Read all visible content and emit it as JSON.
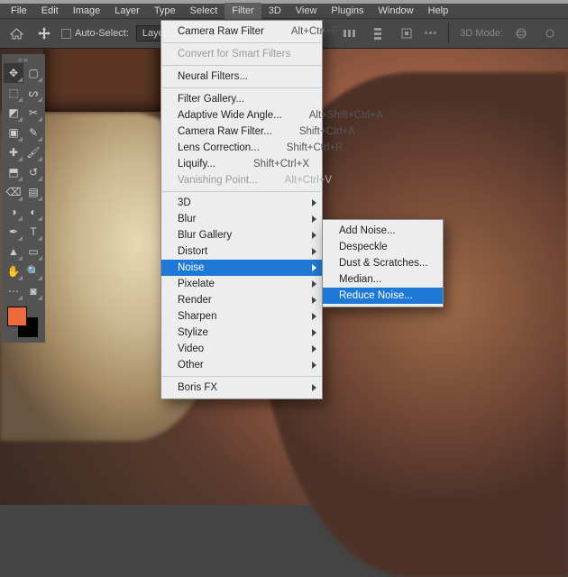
{
  "menubar": {
    "items": [
      "File",
      "Edit",
      "Image",
      "Layer",
      "Type",
      "Select",
      "Filter",
      "3D",
      "View",
      "Plugins",
      "Window",
      "Help"
    ],
    "open_index": 6
  },
  "optbar": {
    "auto_select_label": "Auto-Select:",
    "auto_select_checked": false,
    "target_dropdown": "Layer",
    "mode_label": "3D Mode:"
  },
  "toolbox": {
    "tools": [
      {
        "name": "move-tool",
        "selected": true
      },
      {
        "name": "artboard-tool"
      },
      {
        "name": "rect-marquee-tool"
      },
      {
        "name": "lasso-tool"
      },
      {
        "name": "object-select-tool"
      },
      {
        "name": "crop-tool"
      },
      {
        "name": "frame-tool"
      },
      {
        "name": "eyedropper-tool"
      },
      {
        "name": "healing-brush-tool"
      },
      {
        "name": "brush-tool"
      },
      {
        "name": "clone-stamp-tool"
      },
      {
        "name": "history-brush-tool"
      },
      {
        "name": "eraser-tool"
      },
      {
        "name": "gradient-tool"
      },
      {
        "name": "blur-tool"
      },
      {
        "name": "dodge-tool"
      },
      {
        "name": "pen-tool"
      },
      {
        "name": "type-tool"
      },
      {
        "name": "path-select-tool"
      },
      {
        "name": "rectangle-tool"
      },
      {
        "name": "hand-tool"
      },
      {
        "name": "zoom-tool"
      },
      {
        "name": "edit-toolbar"
      },
      {
        "name": "quick-mask"
      }
    ],
    "foreground_color": "#f06a3c",
    "background_color": "#000000"
  },
  "filter_menu": {
    "sections": [
      [
        {
          "label": "Camera Raw Filter",
          "shortcut": "Alt+Ctrl+F"
        }
      ],
      [
        {
          "label": "Convert for Smart Filters",
          "disabled": true
        }
      ],
      [
        {
          "label": "Neural Filters..."
        }
      ],
      [
        {
          "label": "Filter Gallery..."
        },
        {
          "label": "Adaptive Wide Angle...",
          "shortcut": "Alt+Shift+Ctrl+A"
        },
        {
          "label": "Camera Raw Filter...",
          "shortcut": "Shift+Ctrl+A"
        },
        {
          "label": "Lens Correction...",
          "shortcut": "Shift+Ctrl+R"
        },
        {
          "label": "Liquify...",
          "shortcut": "Shift+Ctrl+X"
        },
        {
          "label": "Vanishing Point...",
          "shortcut": "Alt+Ctrl+V",
          "disabled": true
        }
      ],
      [
        {
          "label": "3D",
          "submenu": true
        },
        {
          "label": "Blur",
          "submenu": true
        },
        {
          "label": "Blur Gallery",
          "submenu": true
        },
        {
          "label": "Distort",
          "submenu": true
        },
        {
          "label": "Noise",
          "submenu": true,
          "highlighted": true
        },
        {
          "label": "Pixelate",
          "submenu": true
        },
        {
          "label": "Render",
          "submenu": true
        },
        {
          "label": "Sharpen",
          "submenu": true
        },
        {
          "label": "Stylize",
          "submenu": true
        },
        {
          "label": "Video",
          "submenu": true
        },
        {
          "label": "Other",
          "submenu": true
        }
      ],
      [
        {
          "label": "Boris FX",
          "submenu": true
        }
      ]
    ]
  },
  "noise_menu": {
    "items": [
      {
        "label": "Add Noise..."
      },
      {
        "label": "Despeckle"
      },
      {
        "label": "Dust & Scratches..."
      },
      {
        "label": "Median..."
      },
      {
        "label": "Reduce Noise...",
        "highlighted": true
      }
    ]
  }
}
